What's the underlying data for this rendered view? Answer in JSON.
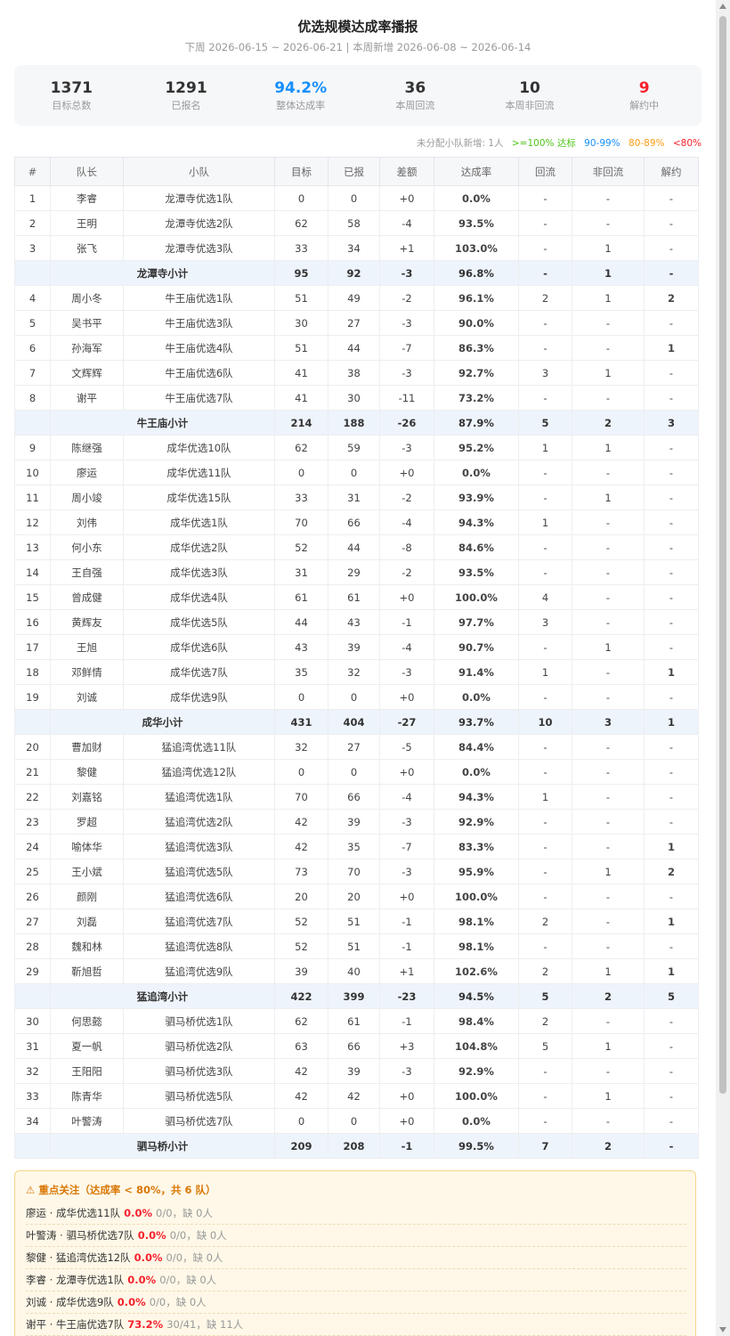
{
  "header": {
    "title": "优选规模达成率播报",
    "subtitle": "下周 2026-06-15 ~ 2026-06-21 | 本周新增 2026-06-08 ~ 2026-06-14"
  },
  "stats": [
    {
      "value": "1371",
      "label": "目标总数",
      "color": "#333333"
    },
    {
      "value": "1291",
      "label": "已报名",
      "color": "#333333"
    },
    {
      "value": "94.2%",
      "label": "整体达成率",
      "color": "#1890ff"
    },
    {
      "value": "36",
      "label": "本周回流",
      "color": "#333333"
    },
    {
      "value": "10",
      "label": "本周非回流",
      "color": "#333333"
    },
    {
      "value": "9",
      "label": "解约中",
      "color": "#f5222d"
    }
  ],
  "legend": {
    "unassigned": "未分配小队新增: 1人",
    "green": ">=100% 达标",
    "blue": "90-99%",
    "orange": "80-89%",
    "red": "<80%"
  },
  "colors": {
    "green": "#52c41a",
    "blue": "#1890ff",
    "orange": "#fa9d14",
    "red": "#f5222d"
  },
  "table": {
    "headers": [
      "#",
      "队长",
      "小队",
      "目标",
      "已报",
      "差额",
      "达成率",
      "回流",
      "非回流",
      "解约"
    ],
    "rows": [
      {
        "type": "row",
        "no": "1",
        "leader": "李睿",
        "team": "龙潭寺优选1队",
        "target": "0",
        "signed": "0",
        "diff": "+0",
        "rate": "0.0%",
        "back": "-",
        "nonback": "-",
        "cancel": "-"
      },
      {
        "type": "row",
        "no": "2",
        "leader": "王明",
        "team": "龙潭寺优选2队",
        "target": "62",
        "signed": "58",
        "diff": "-4",
        "rate": "93.5%",
        "back": "-",
        "nonback": "-",
        "cancel": "-"
      },
      {
        "type": "row",
        "no": "3",
        "leader": "张飞",
        "team": "龙潭寺优选3队",
        "target": "33",
        "signed": "34",
        "diff": "+1",
        "rate": "103.0%",
        "back": "-",
        "nonback": "1",
        "cancel": "-"
      },
      {
        "type": "sub",
        "label": "龙潭寺小计",
        "target": "95",
        "signed": "92",
        "diff": "-3",
        "rate": "96.8%",
        "back": "-",
        "nonback": "1",
        "cancel": "-"
      },
      {
        "type": "row",
        "no": "4",
        "leader": "周小冬",
        "team": "牛王庙优选1队",
        "target": "51",
        "signed": "49",
        "diff": "-2",
        "rate": "96.1%",
        "back": "2",
        "nonback": "1",
        "cancel": "2"
      },
      {
        "type": "row",
        "no": "5",
        "leader": "吴书平",
        "team": "牛王庙优选3队",
        "target": "30",
        "signed": "27",
        "diff": "-3",
        "rate": "90.0%",
        "back": "-",
        "nonback": "-",
        "cancel": "-"
      },
      {
        "type": "row",
        "no": "6",
        "leader": "孙海军",
        "team": "牛王庙优选4队",
        "target": "51",
        "signed": "44",
        "diff": "-7",
        "rate": "86.3%",
        "back": "-",
        "nonback": "-",
        "cancel": "1"
      },
      {
        "type": "row",
        "no": "7",
        "leader": "文辉辉",
        "team": "牛王庙优选6队",
        "target": "41",
        "signed": "38",
        "diff": "-3",
        "rate": "92.7%",
        "back": "3",
        "nonback": "1",
        "cancel": "-"
      },
      {
        "type": "row",
        "no": "8",
        "leader": "谢平",
        "team": "牛王庙优选7队",
        "target": "41",
        "signed": "30",
        "diff": "-11",
        "rate": "73.2%",
        "back": "-",
        "nonback": "-",
        "cancel": "-"
      },
      {
        "type": "sub",
        "label": "牛王庙小计",
        "target": "214",
        "signed": "188",
        "diff": "-26",
        "rate": "87.9%",
        "back": "5",
        "nonback": "2",
        "cancel": "3"
      },
      {
        "type": "row",
        "no": "9",
        "leader": "陈继强",
        "team": "成华优选10队",
        "target": "62",
        "signed": "59",
        "diff": "-3",
        "rate": "95.2%",
        "back": "1",
        "nonback": "1",
        "cancel": "-"
      },
      {
        "type": "row",
        "no": "10",
        "leader": "廖运",
        "team": "成华优选11队",
        "target": "0",
        "signed": "0",
        "diff": "+0",
        "rate": "0.0%",
        "back": "-",
        "nonback": "-",
        "cancel": "-"
      },
      {
        "type": "row",
        "no": "11",
        "leader": "周小竣",
        "team": "成华优选15队",
        "target": "33",
        "signed": "31",
        "diff": "-2",
        "rate": "93.9%",
        "back": "-",
        "nonback": "1",
        "cancel": "-"
      },
      {
        "type": "row",
        "no": "12",
        "leader": "刘伟",
        "team": "成华优选1队",
        "target": "70",
        "signed": "66",
        "diff": "-4",
        "rate": "94.3%",
        "back": "1",
        "nonback": "-",
        "cancel": "-"
      },
      {
        "type": "row",
        "no": "13",
        "leader": "何小东",
        "team": "成华优选2队",
        "target": "52",
        "signed": "44",
        "diff": "-8",
        "rate": "84.6%",
        "back": "-",
        "nonback": "-",
        "cancel": "-"
      },
      {
        "type": "row",
        "no": "14",
        "leader": "王自强",
        "team": "成华优选3队",
        "target": "31",
        "signed": "29",
        "diff": "-2",
        "rate": "93.5%",
        "back": "-",
        "nonback": "-",
        "cancel": "-"
      },
      {
        "type": "row",
        "no": "15",
        "leader": "曾成健",
        "team": "成华优选4队",
        "target": "61",
        "signed": "61",
        "diff": "+0",
        "rate": "100.0%",
        "back": "4",
        "nonback": "-",
        "cancel": "-"
      },
      {
        "type": "row",
        "no": "16",
        "leader": "黄辉友",
        "team": "成华优选5队",
        "target": "44",
        "signed": "43",
        "diff": "-1",
        "rate": "97.7%",
        "back": "3",
        "nonback": "-",
        "cancel": "-"
      },
      {
        "type": "row",
        "no": "17",
        "leader": "王旭",
        "team": "成华优选6队",
        "target": "43",
        "signed": "39",
        "diff": "-4",
        "rate": "90.7%",
        "back": "-",
        "nonback": "1",
        "cancel": "-"
      },
      {
        "type": "row",
        "no": "18",
        "leader": "邓鲜情",
        "team": "成华优选7队",
        "target": "35",
        "signed": "32",
        "diff": "-3",
        "rate": "91.4%",
        "back": "1",
        "nonback": "-",
        "cancel": "1"
      },
      {
        "type": "row",
        "no": "19",
        "leader": "刘诚",
        "team": "成华优选9队",
        "target": "0",
        "signed": "0",
        "diff": "+0",
        "rate": "0.0%",
        "back": "-",
        "nonback": "-",
        "cancel": "-"
      },
      {
        "type": "sub",
        "label": "成华小计",
        "target": "431",
        "signed": "404",
        "diff": "-27",
        "rate": "93.7%",
        "back": "10",
        "nonback": "3",
        "cancel": "1"
      },
      {
        "type": "row",
        "no": "20",
        "leader": "曹加财",
        "team": "猛追湾优选11队",
        "target": "32",
        "signed": "27",
        "diff": "-5",
        "rate": "84.4%",
        "back": "-",
        "nonback": "-",
        "cancel": "-"
      },
      {
        "type": "row",
        "no": "21",
        "leader": "黎健",
        "team": "猛追湾优选12队",
        "target": "0",
        "signed": "0",
        "diff": "+0",
        "rate": "0.0%",
        "back": "-",
        "nonback": "-",
        "cancel": "-"
      },
      {
        "type": "row",
        "no": "22",
        "leader": "刘嘉铭",
        "team": "猛追湾优选1队",
        "target": "70",
        "signed": "66",
        "diff": "-4",
        "rate": "94.3%",
        "back": "1",
        "nonback": "-",
        "cancel": "-"
      },
      {
        "type": "row",
        "no": "23",
        "leader": "罗超",
        "team": "猛追湾优选2队",
        "target": "42",
        "signed": "39",
        "diff": "-3",
        "rate": "92.9%",
        "back": "-",
        "nonback": "-",
        "cancel": "-"
      },
      {
        "type": "row",
        "no": "24",
        "leader": "喻体华",
        "team": "猛追湾优选3队",
        "target": "42",
        "signed": "35",
        "diff": "-7",
        "rate": "83.3%",
        "back": "-",
        "nonback": "-",
        "cancel": "1"
      },
      {
        "type": "row",
        "no": "25",
        "leader": "王小斌",
        "team": "猛追湾优选5队",
        "target": "73",
        "signed": "70",
        "diff": "-3",
        "rate": "95.9%",
        "back": "-",
        "nonback": "1",
        "cancel": "2"
      },
      {
        "type": "row",
        "no": "26",
        "leader": "颜刚",
        "team": "猛追湾优选6队",
        "target": "20",
        "signed": "20",
        "diff": "+0",
        "rate": "100.0%",
        "back": "-",
        "nonback": "-",
        "cancel": "-"
      },
      {
        "type": "row",
        "no": "27",
        "leader": "刘磊",
        "team": "猛追湾优选7队",
        "target": "52",
        "signed": "51",
        "diff": "-1",
        "rate": "98.1%",
        "back": "2",
        "nonback": "-",
        "cancel": "1"
      },
      {
        "type": "row",
        "no": "28",
        "leader": "魏和林",
        "team": "猛追湾优选8队",
        "target": "52",
        "signed": "51",
        "diff": "-1",
        "rate": "98.1%",
        "back": "-",
        "nonback": "-",
        "cancel": "-"
      },
      {
        "type": "row",
        "no": "29",
        "leader": "靳旭哲",
        "team": "猛追湾优选9队",
        "target": "39",
        "signed": "40",
        "diff": "+1",
        "rate": "102.6%",
        "back": "2",
        "nonback": "1",
        "cancel": "1"
      },
      {
        "type": "sub",
        "label": "猛追湾小计",
        "target": "422",
        "signed": "399",
        "diff": "-23",
        "rate": "94.5%",
        "back": "5",
        "nonback": "2",
        "cancel": "5"
      },
      {
        "type": "row",
        "no": "30",
        "leader": "何思懿",
        "team": "驷马桥优选1队",
        "target": "62",
        "signed": "61",
        "diff": "-1",
        "rate": "98.4%",
        "back": "2",
        "nonback": "-",
        "cancel": "-"
      },
      {
        "type": "row",
        "no": "31",
        "leader": "夏一帆",
        "team": "驷马桥优选2队",
        "target": "63",
        "signed": "66",
        "diff": "+3",
        "rate": "104.8%",
        "back": "5",
        "nonback": "1",
        "cancel": "-"
      },
      {
        "type": "row",
        "no": "32",
        "leader": "王阳阳",
        "team": "驷马桥优选3队",
        "target": "42",
        "signed": "39",
        "diff": "-3",
        "rate": "92.9%",
        "back": "-",
        "nonback": "-",
        "cancel": "-"
      },
      {
        "type": "row",
        "no": "33",
        "leader": "陈青华",
        "team": "驷马桥优选5队",
        "target": "42",
        "signed": "42",
        "diff": "+0",
        "rate": "100.0%",
        "back": "-",
        "nonback": "1",
        "cancel": "-"
      },
      {
        "type": "row",
        "no": "34",
        "leader": "叶警涛",
        "team": "驷马桥优选7队",
        "target": "0",
        "signed": "0",
        "diff": "+0",
        "rate": "0.0%",
        "back": "-",
        "nonback": "-",
        "cancel": "-"
      },
      {
        "type": "sub",
        "label": "驷马桥小计",
        "target": "209",
        "signed": "208",
        "diff": "-1",
        "rate": "99.5%",
        "back": "7",
        "nonback": "2",
        "cancel": "-"
      }
    ]
  },
  "focus": {
    "title": "重点关注（达成率 < 80%，共 6 队）",
    "items": [
      {
        "name": "廖运",
        "team": "成华优选11队",
        "rate": "0.0%",
        "meta": "0/0，缺 0人"
      },
      {
        "name": "叶警涛",
        "team": "驷马桥优选7队",
        "rate": "0.0%",
        "meta": "0/0，缺 0人"
      },
      {
        "name": "黎健",
        "team": "猛追湾优选12队",
        "rate": "0.0%",
        "meta": "0/0，缺 0人"
      },
      {
        "name": "李睿",
        "team": "龙潭寺优选1队",
        "rate": "0.0%",
        "meta": "0/0，缺 0人"
      },
      {
        "name": "刘诚",
        "team": "成华优选9队",
        "rate": "0.0%",
        "meta": "0/0，缺 0人"
      },
      {
        "name": "谢平",
        "team": "牛王庙优选7队",
        "rate": "73.2%",
        "meta": "30/41，缺 11人"
      }
    ]
  }
}
